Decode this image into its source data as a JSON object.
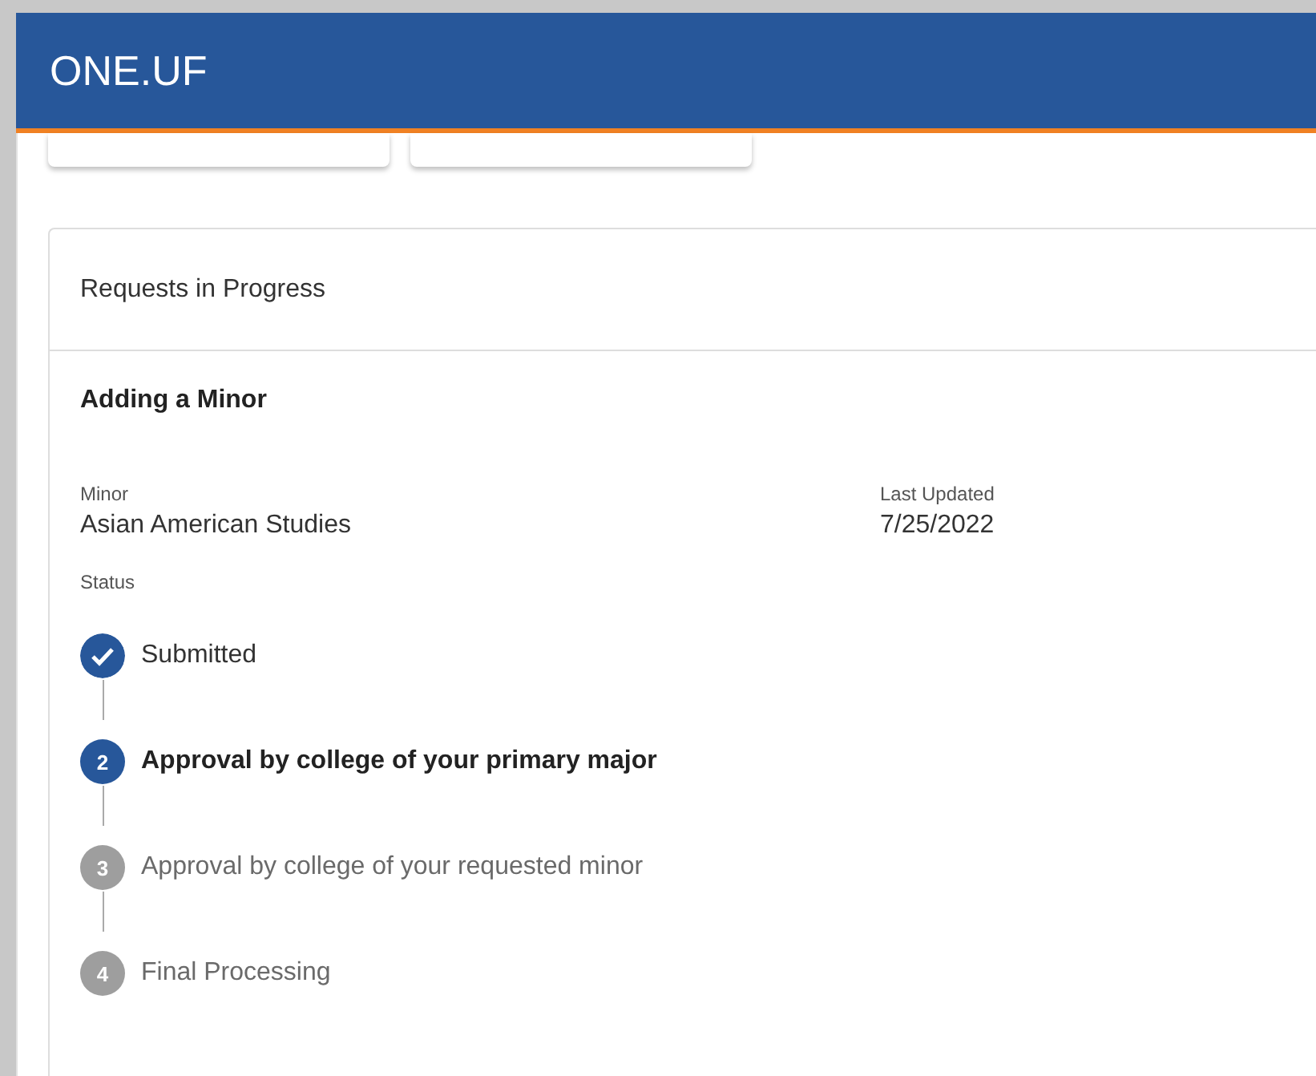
{
  "header": {
    "logo": "ONE.UF"
  },
  "card": {
    "title": "Requests in Progress",
    "request": {
      "title": "Adding a Minor",
      "fields": [
        {
          "label": "Minor",
          "value": "Asian American Studies"
        },
        {
          "label": "Last Updated",
          "value": "7/25/2022"
        }
      ],
      "status_label": "Status",
      "steps": [
        {
          "label": "Submitted",
          "completed": true,
          "current": false
        },
        {
          "number": "2",
          "label": "Approval by college of your primary major",
          "completed": false,
          "current": true
        },
        {
          "number": "3",
          "label": "Approval by college of your requested minor",
          "completed": false,
          "current": false
        },
        {
          "number": "4",
          "label": "Final Processing",
          "completed": false,
          "current": false
        }
      ]
    }
  }
}
